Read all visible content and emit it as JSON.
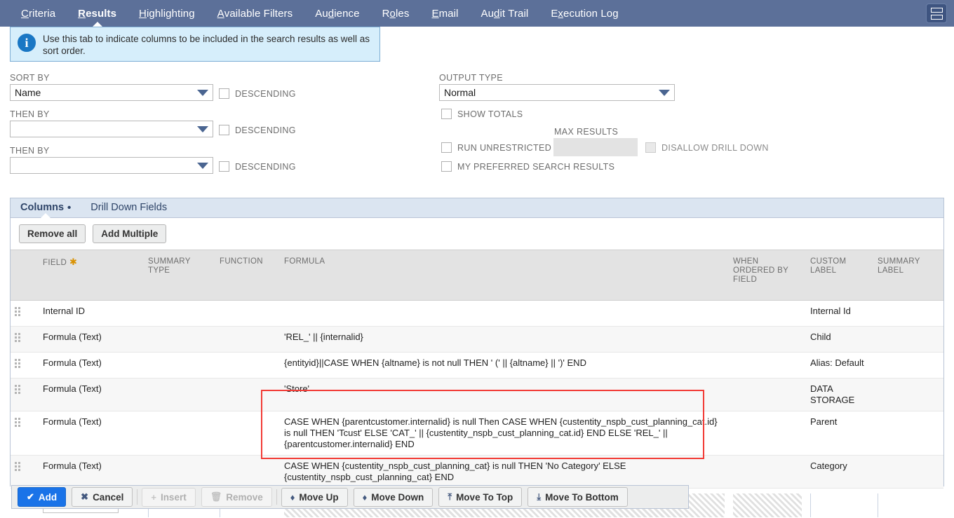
{
  "top_tabs": [
    {
      "label": "Criteria",
      "mnemonic": "C",
      "active": false
    },
    {
      "label": "Results",
      "mnemonic": "R",
      "active": true
    },
    {
      "label": "Highlighting",
      "mnemonic": "H",
      "active": false
    },
    {
      "label": "Available Filters",
      "mnemonic": "A",
      "active": false
    },
    {
      "label": "Audience",
      "mnemonic": "d",
      "active": false
    },
    {
      "label": "Roles",
      "mnemonic": "o",
      "active": false
    },
    {
      "label": "Email",
      "mnemonic": "E",
      "active": false
    },
    {
      "label": "Audit Trail",
      "mnemonic": "d",
      "active": false
    },
    {
      "label": "Execution Log",
      "mnemonic": "x",
      "active": false
    }
  ],
  "header": {
    "menu_icon": "stacked-rows-icon"
  },
  "banner": {
    "icon": "info-icon",
    "text": "Use this tab to indicate columns to be included in the search results as well as sort order."
  },
  "sort": {
    "sort_by_label": "SORT BY",
    "sort_by_value": "Name",
    "then_by_label_1": "THEN BY",
    "then_by_value_1": "",
    "then_by_label_2": "THEN BY",
    "then_by_value_2": "",
    "descending_label": "DESCENDING",
    "descending_checked_1": false,
    "descending_checked_2": false,
    "descending_checked_3": false
  },
  "output": {
    "output_type_label": "OUTPUT TYPE",
    "output_type_value": "Normal",
    "show_totals_label": "SHOW TOTALS",
    "show_totals_checked": false,
    "max_results_label": "MAX RESULTS",
    "max_results_value": "",
    "run_unrestricted_label": "RUN UNRESTRICTED",
    "run_unrestricted_checked": false,
    "disallow_drill_down_label": "DISALLOW DRILL DOWN",
    "disallow_drill_down_checked": false,
    "disallow_drill_down_disabled": true,
    "my_preferred_label": "MY PREFERRED SEARCH RESULTS",
    "my_preferred_checked": false
  },
  "sublist": {
    "tabs": [
      {
        "label": "Columns",
        "active": true,
        "dot": "•"
      },
      {
        "label": "Drill Down Fields",
        "active": false,
        "dot": ""
      }
    ],
    "buttons": [
      {
        "label": "Remove all"
      },
      {
        "label": "Add Multiple"
      }
    ],
    "columns": [
      {
        "key": "field",
        "label": "FIELD",
        "required": true
      },
      {
        "key": "summary_type",
        "label": "SUMMARY TYPE",
        "required": false
      },
      {
        "key": "function",
        "label": "FUNCTION",
        "required": false
      },
      {
        "key": "formula",
        "label": "FORMULA",
        "required": false
      },
      {
        "key": "when_ordered_by_field",
        "label": "WHEN ORDERED BY FIELD",
        "required": false
      },
      {
        "key": "custom_label",
        "label": "CUSTOM LABEL",
        "required": false
      },
      {
        "key": "summary_label",
        "label": "SUMMARY LABEL",
        "required": false
      }
    ],
    "rows": [
      {
        "field": "Internal ID",
        "summary_type": "",
        "function": "",
        "formula": "",
        "when_ordered_by_field": "",
        "custom_label": "Internal Id",
        "summary_label": "",
        "highlighted": false
      },
      {
        "field": "Formula (Text)",
        "summary_type": "",
        "function": "",
        "formula": "'REL_' || {internalid}",
        "when_ordered_by_field": "",
        "custom_label": "Child",
        "summary_label": "",
        "highlighted": false
      },
      {
        "field": "Formula (Text)",
        "summary_type": "",
        "function": "",
        "formula": "{entityid}||CASE WHEN {altname} is not null THEN ' (' || {altname} || ')' END",
        "when_ordered_by_field": "",
        "custom_label": "Alias: Default",
        "summary_label": "",
        "highlighted": false
      },
      {
        "field": "Formula (Text)",
        "summary_type": "",
        "function": "",
        "formula": "'Store'",
        "when_ordered_by_field": "",
        "custom_label": "DATA STORAGE",
        "summary_label": "",
        "highlighted": false
      },
      {
        "field": "Formula (Text)",
        "summary_type": "",
        "function": "",
        "formula": "CASE WHEN {parentcustomer.internalid} is null Then CASE WHEN {custentity_nspb_cust_planning_cat.id} is null THEN 'Tcust' ELSE 'CAT_' || {custentity_nspb_cust_planning_cat.id} END ELSE 'REL_' || {parentcustomer.internalid} END",
        "when_ordered_by_field": "",
        "custom_label": "Parent",
        "summary_label": "",
        "highlighted": true
      },
      {
        "field": "Formula (Text)",
        "summary_type": "",
        "function": "",
        "formula": "CASE WHEN {custentity_nspb_cust_planning_cat} is null THEN 'No Category' ELSE {custentity_nspb_cust_planning_cat} END",
        "when_ordered_by_field": "",
        "custom_label": "Category",
        "summary_label": "",
        "highlighted": true
      }
    ],
    "new_row": {
      "field_value": "",
      "field_icon": "chevron-down-icon"
    }
  },
  "actions": [
    {
      "label": "Add",
      "icon": "check-icon",
      "glyph": "✔",
      "style": "primary",
      "disabled": false
    },
    {
      "label": "Cancel",
      "icon": "x-icon",
      "glyph": "✖",
      "style": "normal",
      "disabled": false
    },
    {
      "label": "Insert",
      "icon": "plus-icon",
      "glyph": "+",
      "style": "normal",
      "disabled": true
    },
    {
      "label": "Remove",
      "icon": "trash-icon",
      "glyph": "🗑",
      "style": "normal",
      "disabled": true
    },
    {
      "label": "Move Up",
      "icon": "arrow-up-icon",
      "glyph": "♦",
      "style": "normal",
      "disabled": false
    },
    {
      "label": "Move Down",
      "icon": "arrow-down-icon",
      "glyph": "♦",
      "style": "normal",
      "disabled": false
    },
    {
      "label": "Move To Top",
      "icon": "arrow-to-top-icon",
      "glyph": "⤒",
      "style": "normal",
      "disabled": false
    },
    {
      "label": "Move To Bottom",
      "icon": "arrow-to-bottom-icon",
      "glyph": "⤓",
      "style": "normal",
      "disabled": false
    }
  ],
  "colors": {
    "tabbar_bg": "#5c7099",
    "banner_bg": "#d6eefb",
    "banner_border": "#7eaed4",
    "primary_button": "#1a73e8",
    "highlight_border": "#f23b36",
    "sublist_tab_bg": "#dbe5f1"
  }
}
